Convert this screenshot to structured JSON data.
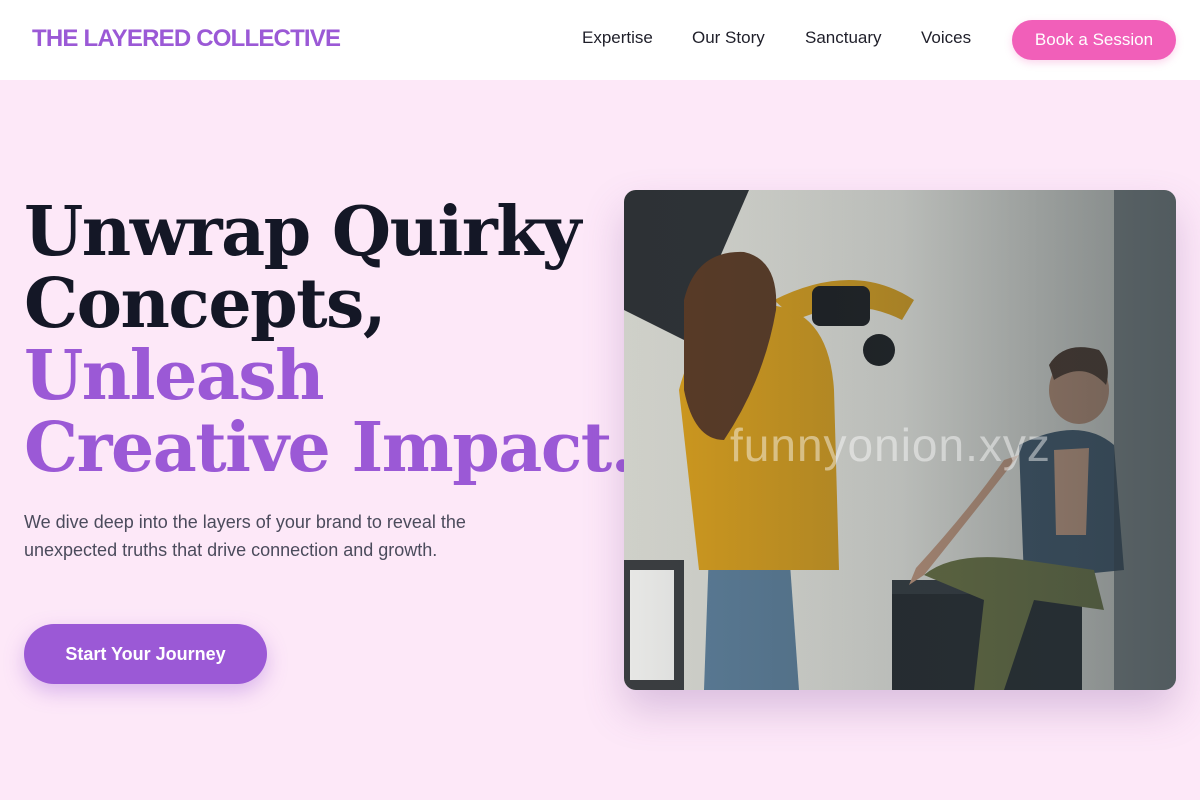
{
  "nav": {
    "logo": "THE LAYERED COLLECTIVE",
    "links": [
      "Expertise",
      "Our Story",
      "Sanctuary",
      "Voices"
    ],
    "cta": "Book a Session"
  },
  "hero": {
    "headline_line1": "Unwrap Quirky",
    "headline_line2": "Concepts,",
    "headline_line3": "Unleash",
    "headline_line4": "Creative Impact.",
    "subtext": "We dive deep into the layers of your brand to reveal the unexpected truths that drive connection and growth.",
    "cta": "Start Your Journey",
    "watermark": "funnyonion.xyz"
  },
  "colors": {
    "background": "#fde8f8",
    "brand_purple": "#9b59d6",
    "brand_pink": "#f15fb9",
    "heading_dark": "#141726"
  }
}
